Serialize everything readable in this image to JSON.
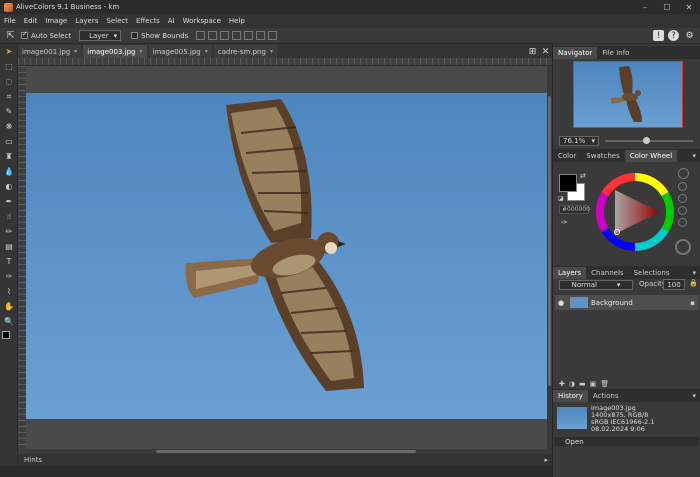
{
  "app": {
    "title": "AliveColors 9.1 Business - km"
  },
  "window_controls": {
    "minimize": "–",
    "maximize": "☐",
    "close": "✕"
  },
  "menu": [
    "File",
    "Edit",
    "Image",
    "Layers",
    "Select",
    "Effects",
    "AI",
    "Workspace",
    "Help"
  ],
  "toolbar": {
    "auto_select_label": "Auto Select",
    "auto_select_checked": true,
    "layer_mode": "Layer",
    "show_bounds_label": "Show Bounds",
    "show_bounds_checked": false
  },
  "top_right_icons": [
    "alert-icon",
    "help-icon",
    "settings-icon"
  ],
  "doc_tabs": [
    {
      "label": "image001.jpg",
      "active": false
    },
    {
      "label": "image003.jpg",
      "active": true
    },
    {
      "label": "image005.jpg",
      "active": false
    },
    {
      "label": "cadre-sm.png",
      "active": false
    }
  ],
  "hints": {
    "label": "Hints"
  },
  "navigator": {
    "tabs": [
      "Navigator",
      "File Info"
    ],
    "zoom": "76.1%"
  },
  "color_panel": {
    "tabs": [
      "Color",
      "Swatches",
      "Color Wheel"
    ],
    "active_tab": "Color Wheel",
    "hex": "#000000",
    "foreground": "#000000",
    "background": "#ffffff"
  },
  "layers_panel": {
    "tabs": [
      "Layers",
      "Channels",
      "Selections"
    ],
    "blend_mode": "Normal",
    "opacity_label": "Opacity:",
    "opacity": "100",
    "layers": [
      {
        "name": "Background",
        "visible": true,
        "locked": true
      }
    ]
  },
  "history_panel": {
    "tabs": [
      "History",
      "Actions"
    ],
    "info": [
      "image003.jpg",
      "1400x875, RGB/8",
      "sRGB IEC61966-2.1",
      "08.02.2024 9:06"
    ],
    "steps": [
      "Open"
    ]
  },
  "colors": {
    "sky": "#5d93c9",
    "accent": "#e8a33d"
  }
}
